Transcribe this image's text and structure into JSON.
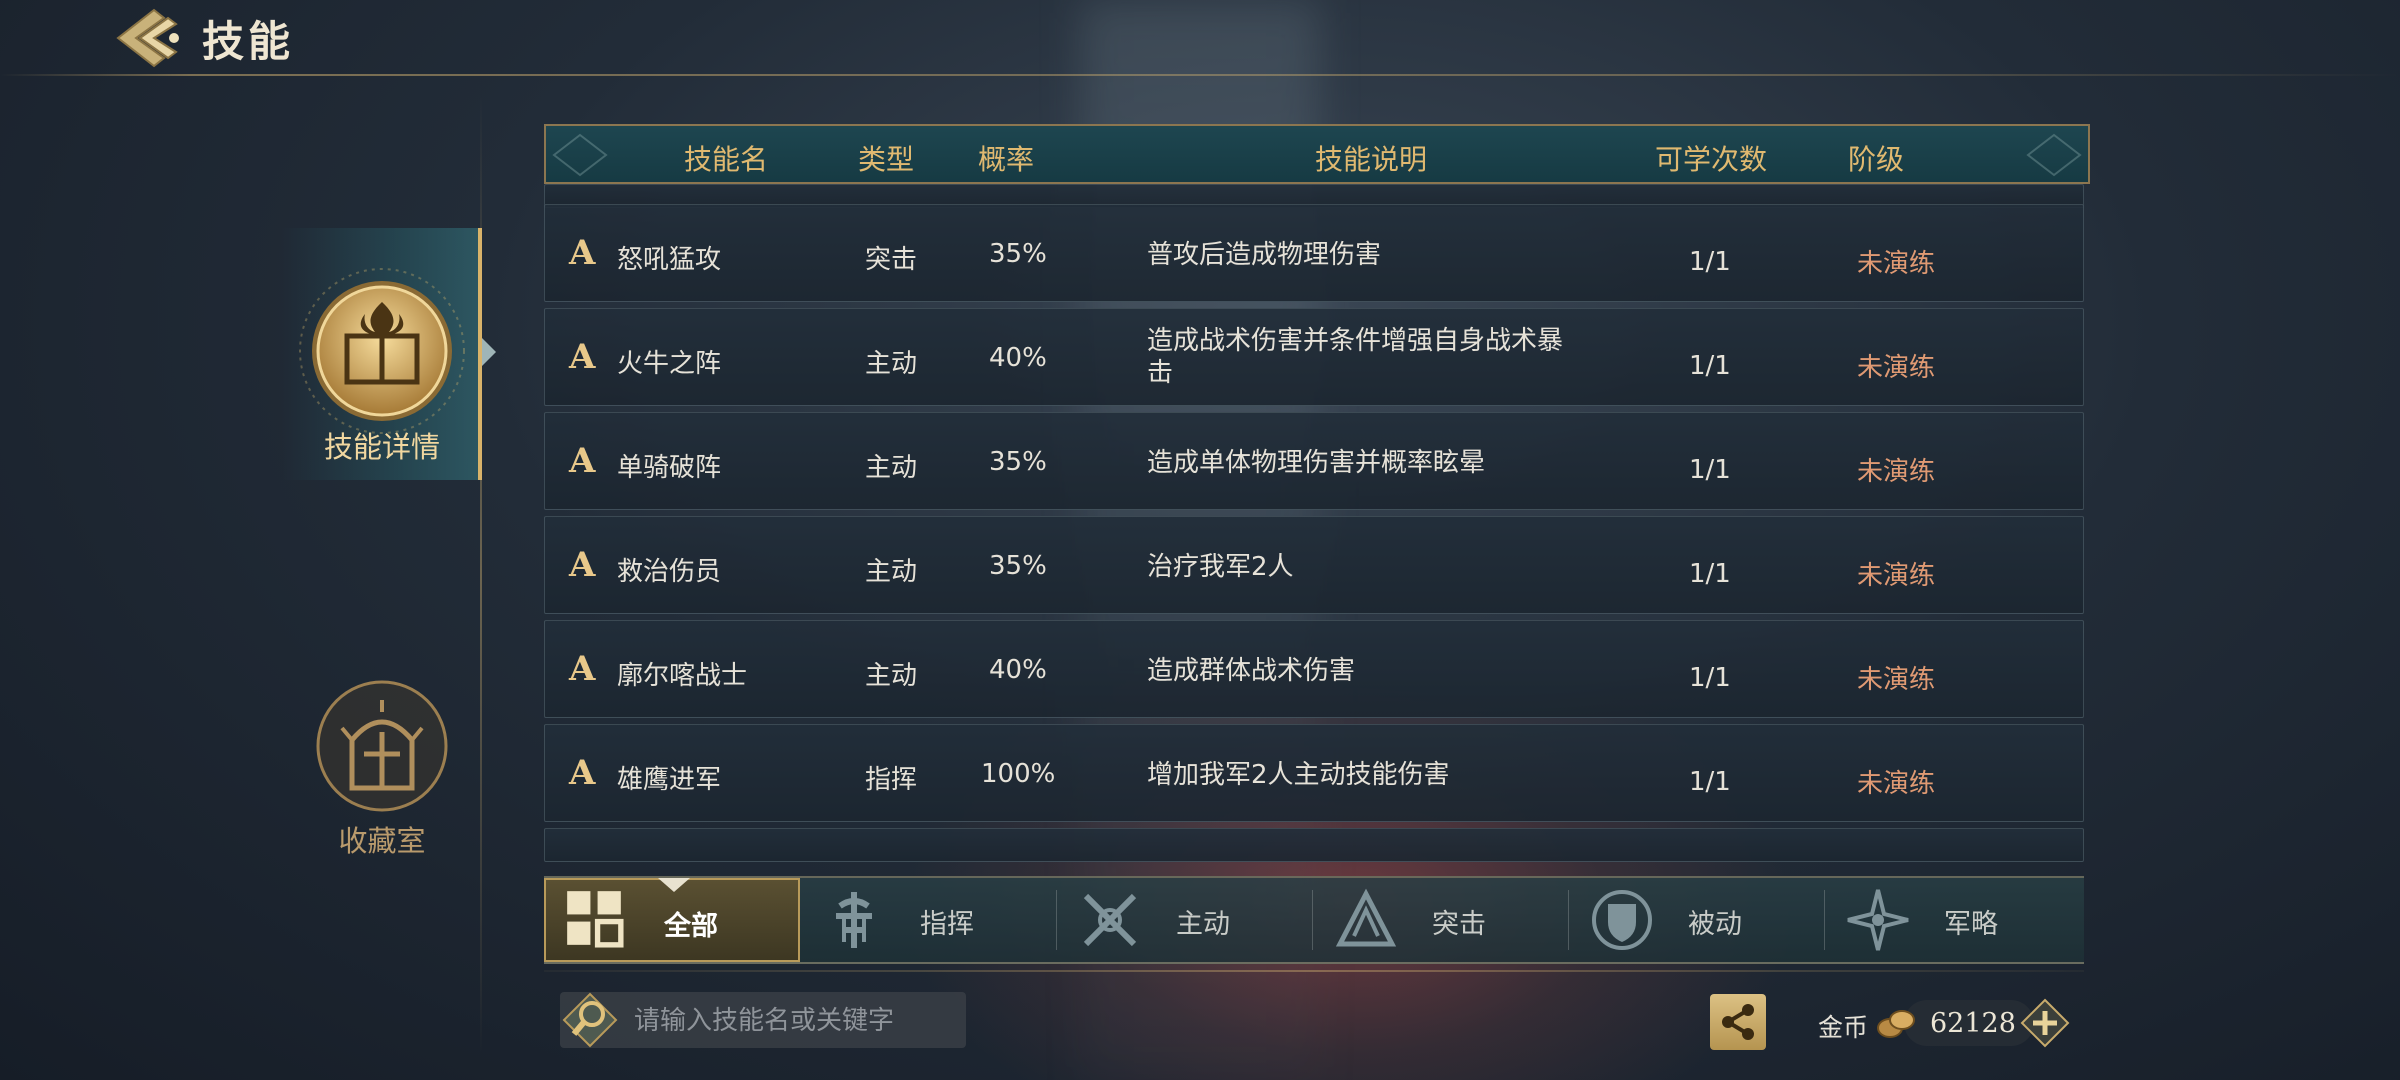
{
  "header": {
    "title": "技能"
  },
  "sidebar": {
    "items": [
      {
        "label": "技能详情",
        "active": true,
        "icon": "skill-book-icon"
      },
      {
        "label": "收藏室",
        "active": false,
        "icon": "collection-hall-icon"
      }
    ]
  },
  "table": {
    "columns": [
      "技能名",
      "类型",
      "概率",
      "技能说明",
      "可学次数",
      "阶级"
    ],
    "rows": [
      {
        "grade": "A",
        "name": "怒吼猛攻",
        "type": "突击",
        "prob": "35%",
        "desc": "普攻后造成物理伤害",
        "count": "1/1",
        "stage": "未演练"
      },
      {
        "grade": "A",
        "name": "火牛之阵",
        "type": "主动",
        "prob": "40%",
        "desc": "造成战术伤害并条件增强自身战术暴击",
        "count": "1/1",
        "stage": "未演练"
      },
      {
        "grade": "A",
        "name": "单骑破阵",
        "type": "主动",
        "prob": "35%",
        "desc": "造成单体物理伤害并概率眩晕",
        "count": "1/1",
        "stage": "未演练"
      },
      {
        "grade": "A",
        "name": "救治伤员",
        "type": "主动",
        "prob": "35%",
        "desc": "治疗我军2人",
        "count": "1/1",
        "stage": "未演练"
      },
      {
        "grade": "A",
        "name": "廓尔喀战士",
        "type": "主动",
        "prob": "40%",
        "desc": "造成群体战术伤害",
        "count": "1/1",
        "stage": "未演练"
      },
      {
        "grade": "A",
        "name": "雄鹰进军",
        "type": "指挥",
        "prob": "100%",
        "desc": "增加我军2人主动技能伤害",
        "count": "1/1",
        "stage": "未演练"
      }
    ]
  },
  "filters": {
    "tabs": [
      {
        "label": "全部",
        "icon": "grid-icon",
        "active": true
      },
      {
        "label": "指挥",
        "icon": "command-icon",
        "active": false
      },
      {
        "label": "主动",
        "icon": "active-icon",
        "active": false
      },
      {
        "label": "突击",
        "icon": "assault-icon",
        "active": false
      },
      {
        "label": "被动",
        "icon": "passive-icon",
        "active": false
      },
      {
        "label": "军略",
        "icon": "strategy-icon",
        "active": false
      }
    ]
  },
  "search": {
    "placeholder": "请输入技能名或关键字",
    "value": ""
  },
  "currency": {
    "label": "金币",
    "value": "62128"
  },
  "colors": {
    "gold": "#e0b970",
    "stage": "#e09a73",
    "accent_teal": "#1e4650"
  }
}
